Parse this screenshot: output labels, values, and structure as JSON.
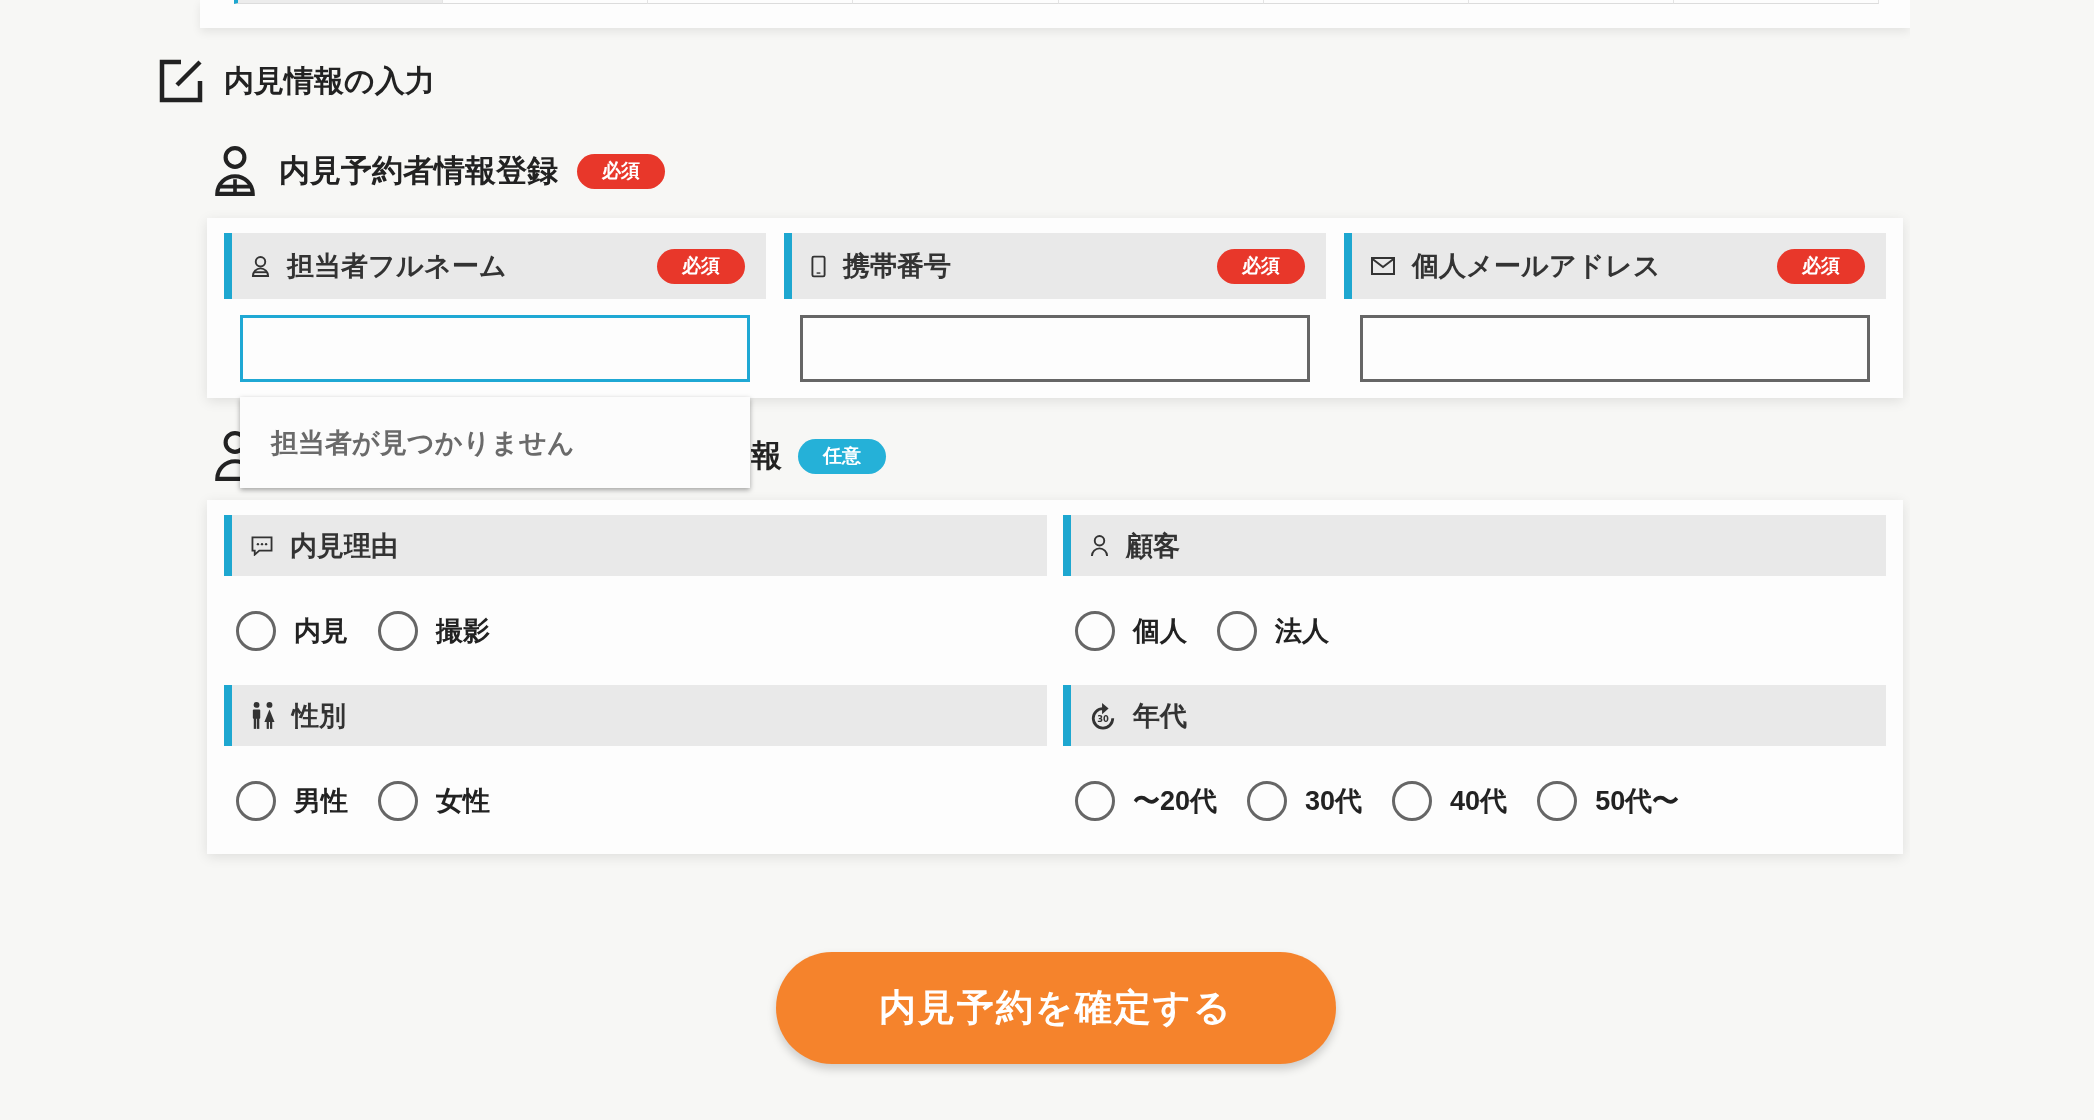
{
  "section": {
    "title": "内見情報の入力"
  },
  "reserver": {
    "title": "内見予約者情報登録",
    "badge": {
      "label": "必須",
      "kind": "required"
    },
    "fields": [
      {
        "kind": "name",
        "label": "担当者フルネーム",
        "badge": {
          "label": "必須",
          "kind": "required"
        },
        "focused": true,
        "dropdown_message": "担当者が見つかりません"
      },
      {
        "kind": "phone",
        "label": "携帯番号",
        "badge": {
          "label": "必須",
          "kind": "required"
        },
        "focused": false
      },
      {
        "kind": "mail",
        "label": "個人メールアドレス",
        "badge": {
          "label": "必須",
          "kind": "required"
        },
        "focused": false
      }
    ]
  },
  "visitor": {
    "title": "報",
    "badge": {
      "label": "任意",
      "kind": "optional"
    },
    "groups": [
      {
        "kind": "reason",
        "label": "内見理由",
        "options": [
          {
            "label": "内見",
            "selected": false
          },
          {
            "label": "撮影",
            "selected": false
          }
        ]
      },
      {
        "kind": "customer",
        "label": "顧客",
        "options": [
          {
            "label": "個人",
            "selected": false
          },
          {
            "label": "法人",
            "selected": false
          }
        ]
      },
      {
        "kind": "gender",
        "label": "性別",
        "options": [
          {
            "label": "男性",
            "selected": false
          },
          {
            "label": "女性",
            "selected": false
          }
        ]
      },
      {
        "kind": "age",
        "label": "年代",
        "icon_text": "30",
        "options": [
          {
            "label": "〜20代",
            "selected": false
          },
          {
            "label": "30代",
            "selected": false
          },
          {
            "label": "40代",
            "selected": false
          },
          {
            "label": "50代〜",
            "selected": false
          }
        ]
      }
    ]
  },
  "submit_button": {
    "label": "内見予約を確定する"
  }
}
